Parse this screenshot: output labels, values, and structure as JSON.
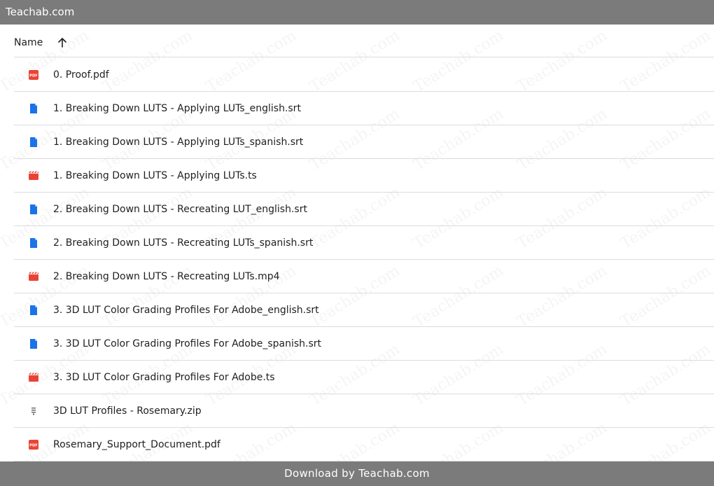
{
  "topbar": {
    "title": "Teachab.com"
  },
  "header": {
    "name_label": "Name",
    "sort_icon": "arrow-up-icon"
  },
  "files": [
    {
      "name": "0. Proof.pdf",
      "type": "pdf",
      "icon": "pdf-icon"
    },
    {
      "name": "1. Breaking Down LUTS - Applying LUTs_english.srt",
      "type": "doc",
      "icon": "document-icon"
    },
    {
      "name": "1. Breaking Down LUTS - Applying LUTs_spanish.srt",
      "type": "doc",
      "icon": "document-icon"
    },
    {
      "name": "1. Breaking Down LUTS - Applying LUTs.ts",
      "type": "video",
      "icon": "video-icon"
    },
    {
      "name": "2. Breaking Down LUTS - Recreating LUT_english.srt",
      "type": "doc",
      "icon": "document-icon"
    },
    {
      "name": "2. Breaking Down LUTS - Recreating LUTs_spanish.srt",
      "type": "doc",
      "icon": "document-icon"
    },
    {
      "name": "2. Breaking Down LUTS - Recreating LUTs.mp4",
      "type": "video",
      "icon": "video-icon"
    },
    {
      "name": "3. 3D LUT Color Grading Profiles For Adobe_english.srt",
      "type": "doc",
      "icon": "document-icon"
    },
    {
      "name": "3. 3D LUT Color Grading Profiles For Adobe_spanish.srt",
      "type": "doc",
      "icon": "document-icon"
    },
    {
      "name": "3. 3D LUT Color Grading Profiles For Adobe.ts",
      "type": "video",
      "icon": "video-icon"
    },
    {
      "name": "3D LUT Profiles - Rosemary.zip",
      "type": "zip",
      "icon": "archive-icon"
    },
    {
      "name": "Rosemary_Support_Document.pdf",
      "type": "pdf",
      "icon": "pdf-icon"
    }
  ],
  "footer": {
    "text": "Download by Teachab.com"
  },
  "watermark": {
    "text": "Teachab.com"
  },
  "colors": {
    "bar": "#7b7b7b",
    "pdf": "#ea4335",
    "doc": "#1a73e8",
    "video": "#ea4335",
    "zip": "#5f6368",
    "divider": "#dadce0"
  }
}
